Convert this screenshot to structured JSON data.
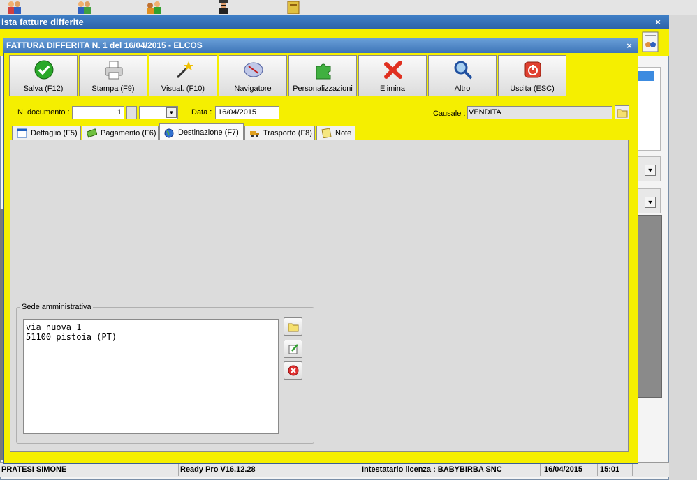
{
  "desktop": {
    "icons": [
      "users-icon",
      "group-icon",
      "team-icon",
      "agent-icon",
      "notebook-icon"
    ]
  },
  "back_window": {
    "title": "ista fatture differite",
    "close_glyph": "×"
  },
  "dialog": {
    "title": "FATTURA DIFFERITA N. 1 del 16/04/2015 - ELCOS",
    "close_glyph": "×",
    "toolbar": [
      {
        "label": "Salva (F12)",
        "icon": "checkmark-icon"
      },
      {
        "label": "Stampa (F9)",
        "icon": "printer-icon"
      },
      {
        "label": "Visual. (F10)",
        "icon": "magic-wand-icon"
      },
      {
        "label": "Navigatore",
        "icon": "compass-icon"
      },
      {
        "label": "Personalizzazioni",
        "icon": "puzzle-icon"
      },
      {
        "label": "Elimina",
        "icon": "delete-x-icon"
      },
      {
        "label": "Altro",
        "icon": "magnifier-icon"
      },
      {
        "label": "Uscita (ESC)",
        "icon": "power-icon"
      }
    ],
    "form": {
      "doc_label": "N. documento :",
      "doc_value": "1",
      "data_label": "Data :",
      "data_value": "16/04/2015",
      "causale_label": "Causale :",
      "causale_value": "VENDITA"
    },
    "tabs": [
      {
        "label": "Dettaglio (F5)",
        "icon": "grid-icon"
      },
      {
        "label": "Pagamento (F6)",
        "icon": "money-icon"
      },
      {
        "label": "Destinazione (F7)",
        "icon": "globe-icon",
        "active": true
      },
      {
        "label": "Trasporto (F8)",
        "icon": "truck-icon"
      },
      {
        "label": "Note",
        "icon": "note-icon"
      }
    ],
    "sede": {
      "group_title": "Sede amministrativa",
      "address": "via nuova 1\n51100 pistoia (PT)"
    }
  },
  "statusbar": {
    "user": "PRATESI SIMONE",
    "version": "Ready Pro V16.12.28",
    "license": "Intestatario licenza : BABYBIRBA SNC",
    "date": "16/04/2015",
    "time": "15:01"
  },
  "colors": {
    "dialog_bg": "#f5ef00",
    "title_bar": "#3d74b8",
    "content_bg": "#dcdcdc"
  }
}
